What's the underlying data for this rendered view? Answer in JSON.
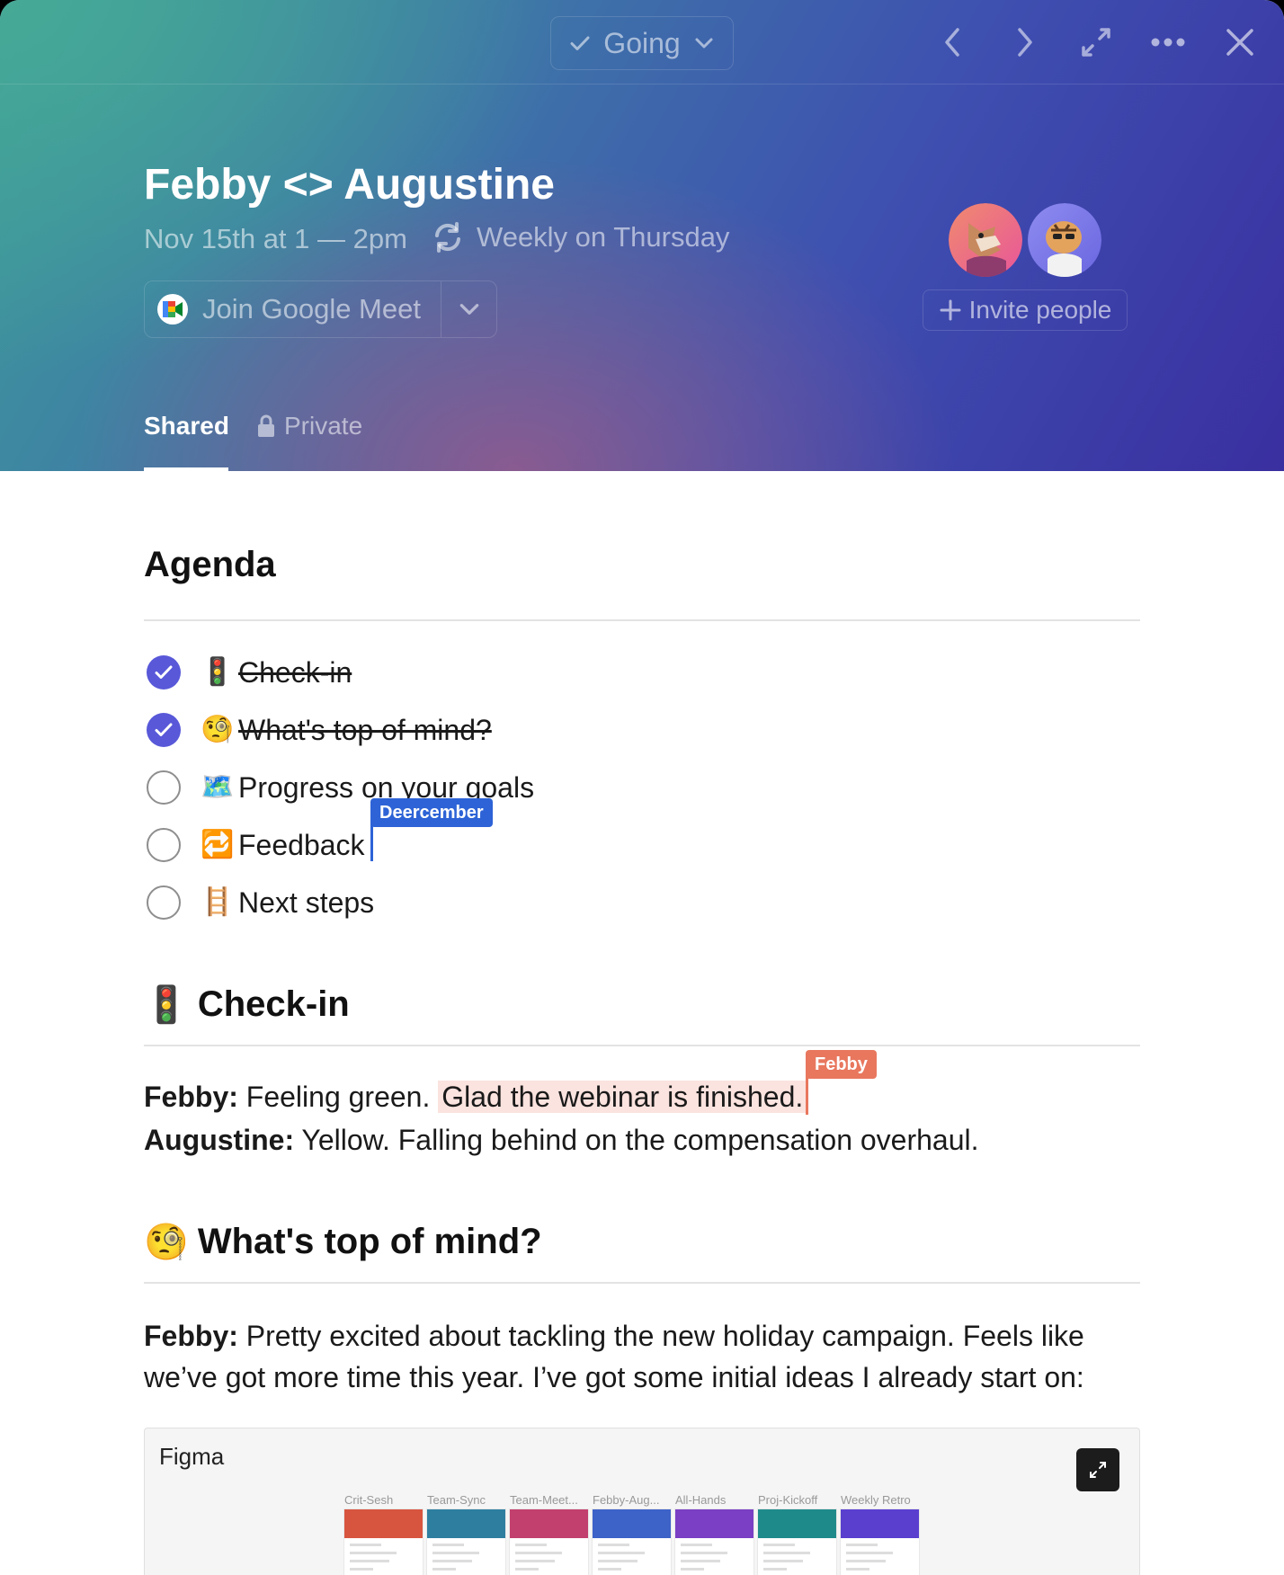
{
  "header": {
    "rsvp": {
      "label": "Going"
    },
    "title": "Febby <> Augustine",
    "datetime": "Nov 15th at 1 — 2pm",
    "recurrence": "Weekly on Thursday",
    "meet": {
      "label": "Join Google Meet"
    },
    "invite_label": "Invite people",
    "tabs": [
      {
        "label": "Shared"
      },
      {
        "label": "Private"
      }
    ]
  },
  "agenda": {
    "title": "Agenda",
    "items": [
      {
        "emoji": "🚦",
        "label": "Check-in",
        "done": true
      },
      {
        "emoji": "🧐",
        "label": "What's top of mind?",
        "done": true
      },
      {
        "emoji": "🗺️",
        "label": "Progress on your goals",
        "done": false
      },
      {
        "emoji": "🔁",
        "label": "Feedback",
        "done": false
      },
      {
        "emoji": "🪜",
        "label": "Next steps",
        "done": false
      }
    ]
  },
  "collaborators": {
    "deer": "Deercember",
    "febby": "Febby"
  },
  "checkin": {
    "emoji": "🚦",
    "title": "Check-in",
    "febby_name": "Febby:",
    "febby_text": " Feeling green. ",
    "febby_highlight": "Glad the webinar is finished.",
    "augustine_name": "Augustine:",
    "augustine_text": " Yellow. Falling behind on the compensation overhaul."
  },
  "top_of_mind": {
    "emoji": "🧐",
    "title": "What's top of mind?",
    "febby_name": "Febby:",
    "line1": " Pretty excited about tackling the new holiday campaign. Feels like",
    "line2": "we’ve got more time this year. I’ve got some initial ideas I already start on:"
  },
  "figma": {
    "label": "Figma",
    "frames": [
      "Crit-Sesh",
      "Team-Sync",
      "Team-Meet...",
      "Febby-Aug...",
      "All-Hands",
      "Proj-Kickoff",
      "Weekly Retro"
    ],
    "frame_colors": [
      "#d7553f",
      "#2e7ea0",
      "#c2406e",
      "#3d62c8",
      "#7a3fc4",
      "#1f8a8a",
      "#5a3fcf"
    ]
  }
}
